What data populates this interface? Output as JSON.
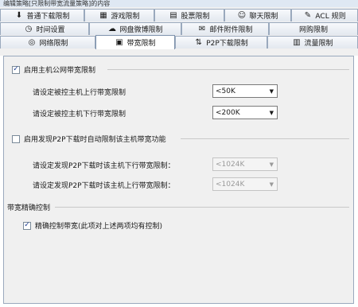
{
  "window": {
    "title": "编辑策略[只限制带宽流量策略]的内容"
  },
  "tabs": {
    "row1": [
      {
        "label": "普通下载限制",
        "icon": "download-icon"
      },
      {
        "label": "游戏限制",
        "icon": "game-icon"
      },
      {
        "label": "股票限制",
        "icon": "stock-icon"
      },
      {
        "label": "聊天限制",
        "icon": "chat-icon"
      },
      {
        "label": "ACL 规则",
        "icon": "acl-icon"
      }
    ],
    "row2": [
      {
        "label": "时间设置",
        "icon": "clock-icon"
      },
      {
        "label": "网盘微博限制",
        "icon": "cloud-icon"
      },
      {
        "label": "邮件附件限制",
        "icon": "mail-icon"
      },
      {
        "label": "网购限制",
        "icon": "cart-icon"
      }
    ],
    "row3": [
      {
        "label": "网络限制",
        "icon": "network-icon"
      },
      {
        "label": "带宽限制",
        "icon": "bandwidth-icon",
        "active": true
      },
      {
        "label": "P2P下载限制",
        "icon": "p2p-icon"
      },
      {
        "label": "流量限制",
        "icon": "traffic-icon"
      }
    ]
  },
  "bandwidth": {
    "enable_public_label": "启用主机公网带宽限制",
    "enable_public_checked": true,
    "upload_label": "请设定被控主机上行带宽限制",
    "upload_value": "<50K",
    "download_label": "请设定被控主机下行带宽限制",
    "download_value": "<200K",
    "p2p_enable_label": "启用发现P2P下载时自动限制该主机带宽功能",
    "p2p_enable_checked": false,
    "p2p_download_label": "请设定发现P2P下载时该主机下行带宽限制：",
    "p2p_download_value": "<1024K",
    "p2p_upload_label": "请设定发现P2P下载时该主机上行带宽限制：",
    "p2p_upload_value": "<1024K",
    "precise_section_title": "带宽精确控制",
    "precise_label": "精确控制带宽(此项对上述两项均有控制)",
    "precise_checked": true
  }
}
